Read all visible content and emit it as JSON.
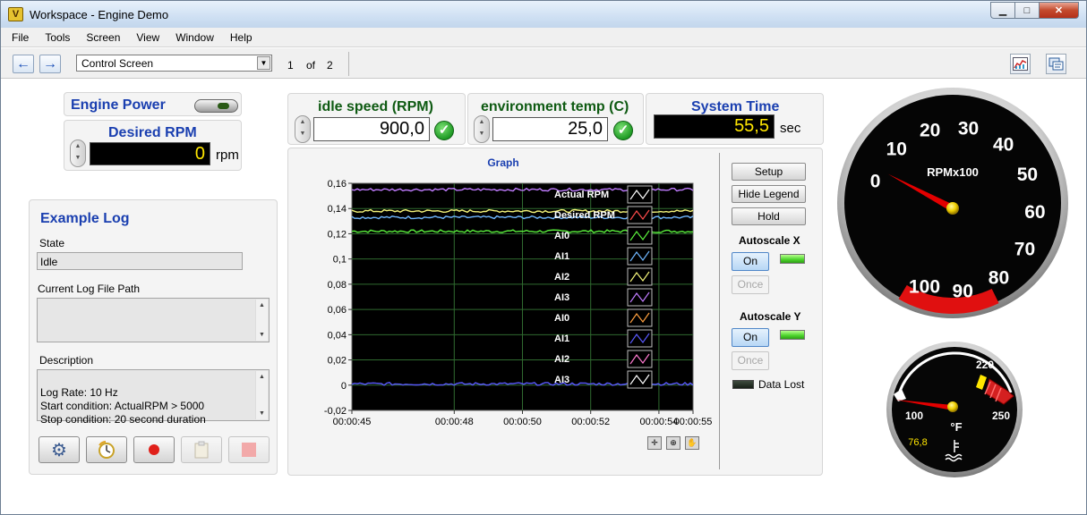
{
  "window": {
    "title": "Workspace - Engine Demo",
    "app_icon_glyph": "V",
    "buttons": {
      "minimize": "▁",
      "maximize": "□",
      "close": "✕"
    }
  },
  "menu": [
    "File",
    "Tools",
    "Screen",
    "View",
    "Window",
    "Help"
  ],
  "toolbar": {
    "back_glyph": "←",
    "forward_glyph": "→",
    "screen": "Control Screen",
    "page": "1",
    "of_label": "of",
    "total_pages": "2",
    "right_icons": [
      "chart-icon",
      "screens-icon"
    ]
  },
  "engine_power": {
    "label": "Engine Power",
    "on": true
  },
  "desired_rpm": {
    "label": "Desired RPM",
    "value": "0",
    "unit": "rpm"
  },
  "idle_speed": {
    "label": "idle speed (RPM)",
    "value": "900,0"
  },
  "env_temp": {
    "label": "environment temp (C)",
    "value": "25,0"
  },
  "system_time": {
    "label": "System Time",
    "value": "55,5",
    "unit": "sec"
  },
  "log": {
    "title": "Example Log",
    "state_label": "State",
    "state_value": "Idle",
    "path_label": "Current Log File Path",
    "path_value": "",
    "desc_label": "Description",
    "desc_value": "Log Rate: 10 Hz\nStart condition: ActualRPM > 5000\nStop condition: 20 second duration",
    "buttons": [
      "settings-gear-icon",
      "timer-icon",
      "record-icon",
      "clipboard-icon",
      "stop-icon"
    ]
  },
  "graph_controls": {
    "setup": "Setup",
    "hide_legend": "Hide Legend",
    "hold": "Hold",
    "autoscale_x_label": "Autoscale X",
    "autoscale_x_on": "On",
    "autoscale_x_once": "Once",
    "autoscale_y_label": "Autoscale Y",
    "autoscale_y_on": "On",
    "autoscale_y_once": "Once",
    "data_lost": "Data Lost"
  },
  "chart_data": {
    "type": "line",
    "title": "Graph",
    "xlabel": "",
    "ylabel": "",
    "x_ticks": [
      "00:00:45",
      "00:00:48",
      "00:00:50",
      "00:00:52",
      "00:00:54",
      "00:00:55"
    ],
    "y_ticks": [
      "0,16",
      "0,14",
      "0,12",
      "0,1",
      "0,08",
      "0,06",
      "0,04",
      "0,02",
      "0",
      "-0,02"
    ],
    "ylim": [
      -0.02,
      0.16
    ],
    "legend_position": "top-right",
    "grid": true,
    "series": [
      {
        "name": "Actual RPM",
        "color": "#ffffff",
        "level": null
      },
      {
        "name": "Desired RPM",
        "color": "#ff4b4b",
        "level": null
      },
      {
        "name": "AI0",
        "color": "#5af03c",
        "level": 0.122
      },
      {
        "name": "AI1",
        "color": "#6fb7ff",
        "level": 0.133
      },
      {
        "name": "AI2",
        "color": "#f5f57a",
        "level": 0.138
      },
      {
        "name": "AI3",
        "color": "#c07cff",
        "level": 0.155
      },
      {
        "name": "AI0",
        "color": "#ffa040",
        "level": null
      },
      {
        "name": "AI1",
        "color": "#5a5aff",
        "level": 0.001
      },
      {
        "name": "AI2",
        "color": "#ff7ad0",
        "level": null
      },
      {
        "name": "AI3",
        "color": "#ffffff",
        "level": null
      }
    ]
  },
  "tools": [
    "crosshair-icon",
    "zoom-icon",
    "pan-hand-icon"
  ],
  "rpm_gauge": {
    "label": "RPMx100",
    "ticks": [
      "0",
      "10",
      "20",
      "30",
      "40",
      "50",
      "60",
      "70",
      "80",
      "90",
      "100"
    ],
    "value": 0
  },
  "temp_gauge": {
    "unit": "°F",
    "ticks": [
      "100",
      "220",
      "250"
    ],
    "value": "76,8",
    "icon": "engine-coolant-icon"
  }
}
